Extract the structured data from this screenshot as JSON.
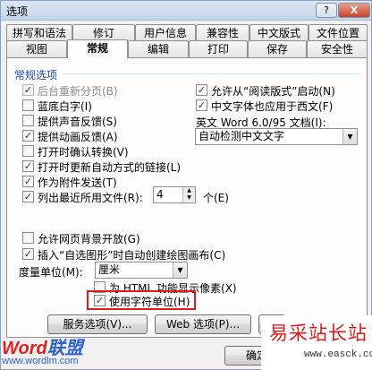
{
  "window": {
    "title": "选项",
    "help_label": "?",
    "close_label": "X"
  },
  "tabs_top": [
    "拼写和语法",
    "修订",
    "用户信息",
    "兼容性",
    "中文版式",
    "文件位置"
  ],
  "tabs_bottom": [
    "视图",
    "常规",
    "编辑",
    "打印",
    "保存",
    "安全性"
  ],
  "active_tab": "常规",
  "general": {
    "group_title": "常规选项",
    "left_options": [
      {
        "label": "后台重新分页(B)",
        "checked": true,
        "disabled": true
      },
      {
        "label": "蓝底白字(I)",
        "checked": false,
        "disabled": false
      },
      {
        "label": "提供声音反馈(S)",
        "checked": false,
        "disabled": false
      },
      {
        "label": "提供动画反馈(A)",
        "checked": true,
        "disabled": false
      },
      {
        "label": "打开时确认转换(V)",
        "checked": false,
        "disabled": false
      },
      {
        "label": "打开时更新自动方式的链接(L)",
        "checked": true,
        "disabled": false
      },
      {
        "label": "作为附件发送(T)",
        "checked": true,
        "disabled": false
      },
      {
        "label": "列出最近所用文件(R):",
        "checked": true,
        "disabled": false
      }
    ],
    "recent_files_count": "4",
    "recent_files_unit": "个(E)",
    "right_options": [
      {
        "label": "允许从“阅读版式”启动(N)",
        "checked": true
      },
      {
        "label": "中文字体也应用于西文(F)",
        "checked": true
      }
    ],
    "word_files_label": "英文 Word 6.0/95 文档(I):",
    "word_files_value": "自动检测中文文字",
    "lower_options": [
      {
        "label": "允许网页背景开放(G)",
        "checked": false
      },
      {
        "label": "插入“自选图形”时自动创建绘图画布(C)",
        "checked": true
      }
    ],
    "unit_label": "度量单位(M):",
    "unit_value": "厘米",
    "html_pixels": {
      "label": "为 HTML 功能显示像素(X)",
      "checked": false
    },
    "char_units": {
      "label": "使用字符单位(H)",
      "checked": true
    },
    "service_button": "服务选项(V)...",
    "web_button": "Web 选项(P)...",
    "email_button_partial": "E",
    "ok_button": "确定"
  },
  "watermarks": {
    "brand_red": "Word",
    "brand_blue": "联盟",
    "brand_url": "www.wordlm.com",
    "site_name": "易采站长站",
    "site_url": "www.easck.com"
  }
}
